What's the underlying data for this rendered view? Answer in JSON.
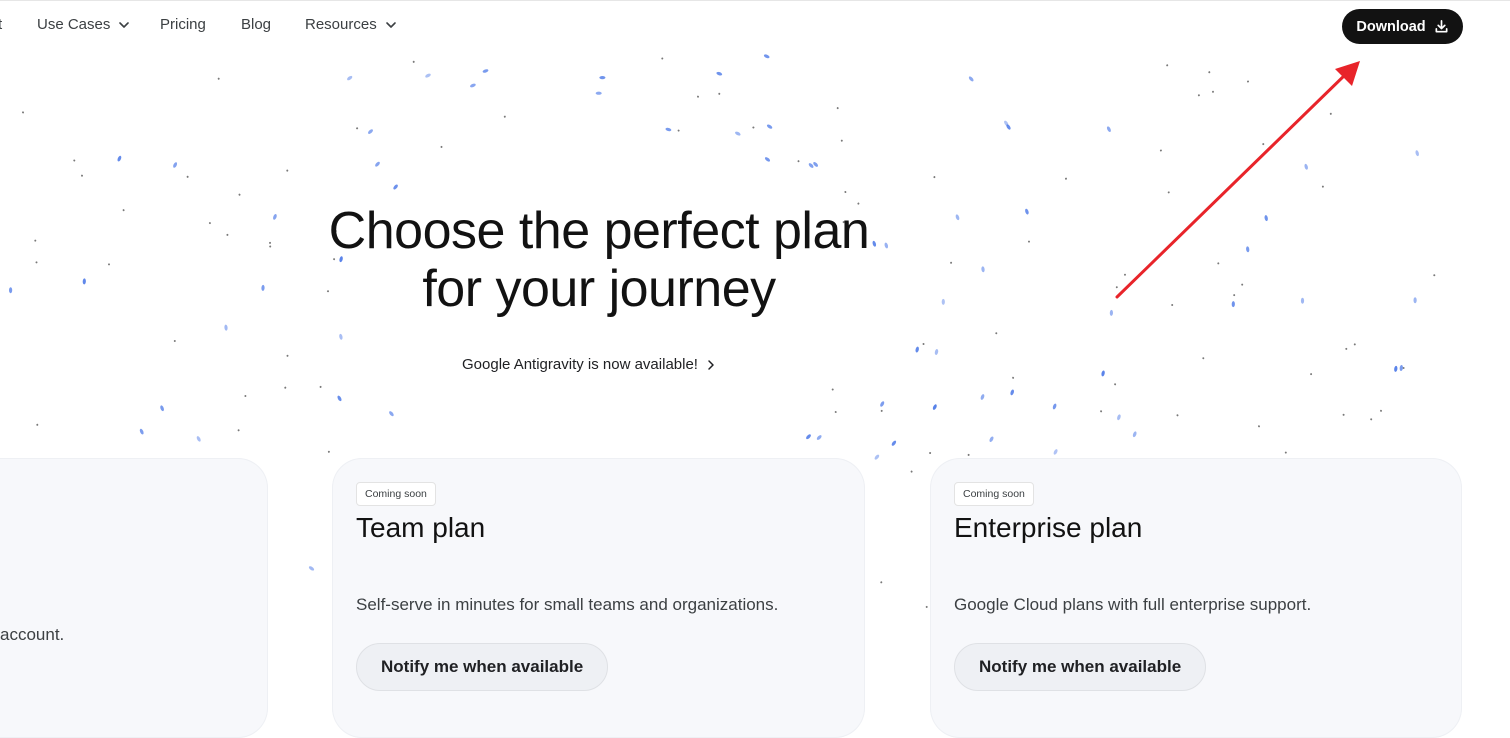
{
  "nav": {
    "partial_item": "t",
    "use_cases_label": "Use Cases",
    "pricing_label": "Pricing",
    "blog_label": "Blog",
    "resources_label": "Resources",
    "download_label": "Download",
    "icons": {
      "use_cases": "chevron-down-icon",
      "resources": "chevron-down-icon",
      "download": "download-icon"
    }
  },
  "hero": {
    "title_line1": "Choose the perfect plan",
    "title_line2": "for your journey",
    "announcement": "Google Antigravity is now available!",
    "announcement_icon": "chevron-right-icon"
  },
  "cards": {
    "left": {
      "partial_desc": "account."
    },
    "team": {
      "badge": "Coming soon",
      "title": "Team plan",
      "description": "Self-serve in minutes for small teams and organizations.",
      "button": "Notify me when available"
    },
    "enterprise": {
      "badge": "Coming soon",
      "title": "Enterprise plan",
      "description": "Google Cloud plans with full enterprise support.",
      "button": "Notify me when available"
    }
  },
  "colors": {
    "particle": "#4f7be8",
    "download_bg": "#121212",
    "card_bg": "#f7f8fb",
    "annotation_arrow": "#e8242a"
  }
}
